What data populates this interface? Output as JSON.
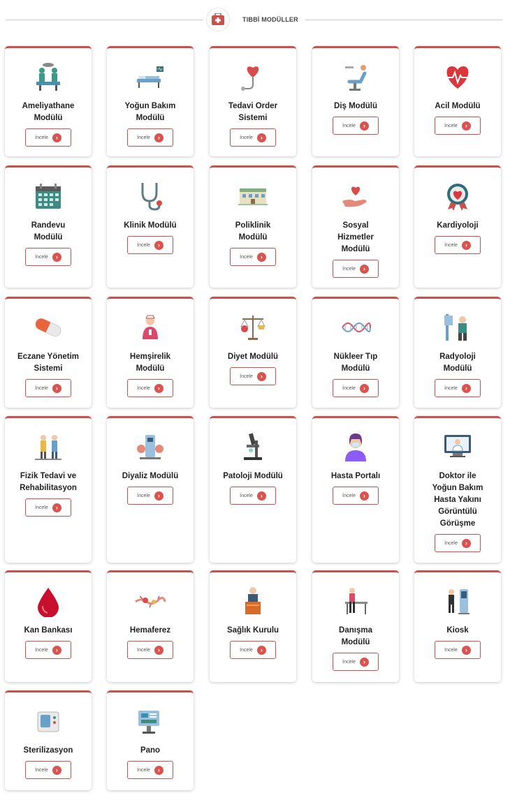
{
  "header": {
    "title": "TIBBİ MODÜLLER",
    "icon": "first-aid-kit-icon",
    "accent": "#c8514a"
  },
  "button_label": "İncele",
  "modules": [
    {
      "lines": [
        "Ameliyathane",
        "Modülü"
      ],
      "icon": "operating-room-icon"
    },
    {
      "lines": [
        "Yoğun Bakım",
        "Modülü"
      ],
      "icon": "intensive-care-bed-icon"
    },
    {
      "lines": [
        "Tedavi Order",
        "Sistemi"
      ],
      "icon": "heart-stethoscope-icon"
    },
    {
      "lines": [
        "Diş Modülü"
      ],
      "icon": "dental-chair-icon"
    },
    {
      "lines": [
        "Acil Modülü"
      ],
      "icon": "heartbeat-icon"
    },
    {
      "lines": [
        "Randevu",
        "Modülü"
      ],
      "icon": "calendar-icon"
    },
    {
      "lines": [
        "Klinik Modülü"
      ],
      "icon": "stethoscope-icon"
    },
    {
      "lines": [
        "Poliklinik",
        "Modülü"
      ],
      "icon": "clinic-building-icon"
    },
    {
      "lines": [
        "Sosyal",
        "Hizmetler",
        "Modülü"
      ],
      "icon": "heart-hand-icon"
    },
    {
      "lines": [
        "Kardiyoloji"
      ],
      "icon": "cardiology-badge-icon"
    },
    {
      "lines": [
        "Eczane Yönetim",
        "Sistemi"
      ],
      "icon": "pill-capsule-icon"
    },
    {
      "lines": [
        "Hemşirelik",
        "Modülü"
      ],
      "icon": "nurse-icon"
    },
    {
      "lines": [
        "Diyet Modülü"
      ],
      "icon": "scale-balance-icon"
    },
    {
      "lines": [
        "Nükleer Tıp",
        "Modülü"
      ],
      "icon": "dna-icon"
    },
    {
      "lines": [
        "Radyoloji",
        "Modülü"
      ],
      "icon": "xray-scanner-icon"
    },
    {
      "lines": [
        "Fizik Tedavi ve",
        "Rehabilitasyon"
      ],
      "icon": "physiotherapy-icon"
    },
    {
      "lines": [
        "Diyaliz Modülü"
      ],
      "icon": "dialysis-icon"
    },
    {
      "lines": [
        "Patoloji Modülü"
      ],
      "icon": "microscope-icon"
    },
    {
      "lines": [
        "Hasta Portalı"
      ],
      "icon": "patient-avatar-icon"
    },
    {
      "lines": [
        "Doktor ile",
        "Yoğun Bakım",
        "Hasta Yakını",
        "Görüntülü",
        "Görüşme"
      ],
      "icon": "video-doctor-icon"
    },
    {
      "lines": [
        "Kan Bankası"
      ],
      "icon": "blood-drop-icon"
    },
    {
      "lines": [
        "Hemaferez"
      ],
      "icon": "blood-cell-icon"
    },
    {
      "lines": [
        "Sağlık Kurulu"
      ],
      "icon": "podium-speaker-icon"
    },
    {
      "lines": [
        "Danışma",
        "Modülü"
      ],
      "icon": "reception-desk-icon"
    },
    {
      "lines": [
        "Kiosk"
      ],
      "icon": "kiosk-icon"
    },
    {
      "lines": [
        "Sterilizasyon"
      ],
      "icon": "sterilizer-icon"
    },
    {
      "lines": [
        "Pano"
      ],
      "icon": "dashboard-board-icon"
    }
  ]
}
